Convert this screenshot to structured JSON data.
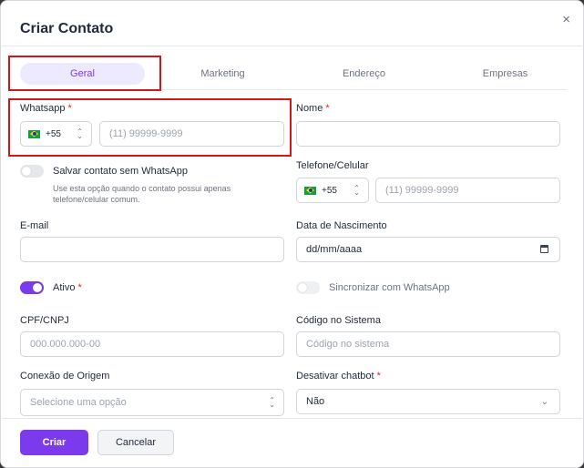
{
  "dialog": {
    "title": "Criar Contato",
    "close_glyph": "×"
  },
  "tabs": [
    {
      "label": "Geral",
      "active": true
    },
    {
      "label": "Marketing",
      "active": false
    },
    {
      "label": "Endereço",
      "active": false
    },
    {
      "label": "Empresas",
      "active": false
    }
  ],
  "form": {
    "whatsapp": {
      "label": "Whatsapp",
      "required_mark": "*",
      "country_code": "+55",
      "placeholder": "(11) 99999-9999"
    },
    "nome": {
      "label": "Nome",
      "required_mark": "*",
      "value": ""
    },
    "save_without_whatsapp": {
      "label": "Salvar contato sem WhatsApp",
      "help_line1": "Use esta opção quando o contato possui apenas",
      "help_line2": "telefone/celular comum.",
      "enabled": false
    },
    "telefone": {
      "label": "Telefone/Celular",
      "country_code": "+55",
      "placeholder": "(11) 99999-9999"
    },
    "email": {
      "label": "E-mail",
      "value": ""
    },
    "data_nascimento": {
      "label": "Data de Nascimento",
      "placeholder": "dd/mm/aaaa"
    },
    "ativo": {
      "label": "Ativo",
      "required_mark": "*",
      "enabled": true
    },
    "sincronizar": {
      "label": "Sincronizar com WhatsApp",
      "enabled": false,
      "disabled": true
    },
    "cpf_cnpj": {
      "label": "CPF/CNPJ",
      "placeholder": "000.000.000-00"
    },
    "codigo_sistema": {
      "label": "Código no Sistema",
      "placeholder": "Código no sistema"
    },
    "conexao_origem": {
      "label": "Conexão de Origem",
      "placeholder": "Selecione uma opção"
    },
    "desativar_chatbot": {
      "label": "Desativar chatbot",
      "required_mark": "*",
      "selected": "Não"
    }
  },
  "footer": {
    "create_label": "Criar",
    "cancel_label": "Cancelar"
  },
  "colors": {
    "accent": "#7c3aed",
    "highlight": "#d4161b"
  },
  "icons": {
    "close": "close-icon",
    "flag": "brazil-flag-icon",
    "select_updown": "chevron-up-down-icon",
    "calendar": "calendar-icon",
    "dropdown": "chevron-down-icon"
  }
}
